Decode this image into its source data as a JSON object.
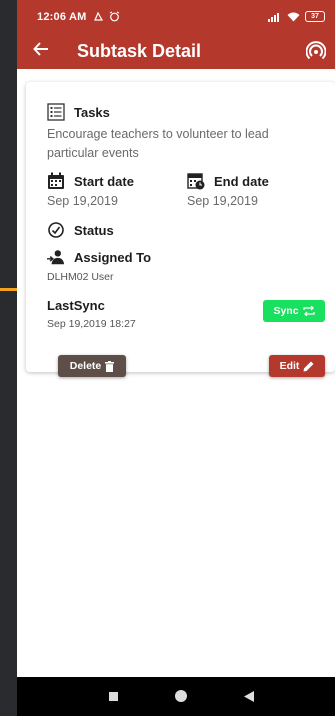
{
  "status_bar": {
    "time": "12:06 AM",
    "battery": "37"
  },
  "app_bar": {
    "title": "Subtask Detail"
  },
  "card": {
    "tasks_label": "Tasks",
    "tasks_value": "Encourage teachers to volunteer to lead particular events",
    "start_label": "Start date",
    "start_value": "Sep 19,2019",
    "end_label": "End date",
    "end_value": "Sep 19,2019",
    "status_label": "Status",
    "assigned_label": "Assigned To",
    "assigned_value": "DLHM02 User",
    "lastsync_label": "LastSync",
    "lastsync_value": "Sep 19,2019 18:27",
    "sync_button": "Sync",
    "delete_button": "Delete",
    "edit_button": "Edit"
  },
  "colors": {
    "primary": "#b5382d",
    "sync_green": "#19e05e",
    "delete_brown": "#5d4f48"
  },
  "icons": {
    "back": "arrow-left-icon",
    "sync_top": "sync-signal-icon",
    "tasks": "task-list-icon",
    "start": "calendar-icon",
    "end": "calendar-clock-icon",
    "status": "clock-check-icon",
    "assigned": "person-assign-icon",
    "sync": "sync-arrows-icon",
    "delete": "trash-icon",
    "edit": "pencil-icon"
  }
}
